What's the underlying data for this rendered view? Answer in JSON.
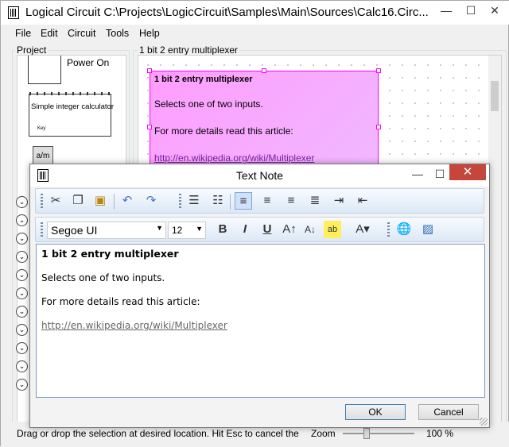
{
  "window": {
    "title": "Logical Circuit C:\\Projects\\LogicCircuit\\Samples\\Main\\Sources\\Calc16.Circ..."
  },
  "menu": [
    "File",
    "Edit",
    "Circuit",
    "Tools",
    "Help"
  ],
  "project": {
    "label": "Project",
    "power_on": "Power On",
    "calculator": "Simple integer calculator",
    "key": "Key",
    "am_button": "a/m",
    "circle_glyph": "⌄"
  },
  "canvas": {
    "label": "1 bit 2 entry multiplexer",
    "note": {
      "title": "1 bit 2 entry multiplexer",
      "line1": "Selects one of two inputs.",
      "line2": "For more details read this article:",
      "link": "http://en.wikipedia.org/wiki/Multiplexer"
    }
  },
  "status": {
    "text": "Drag or drop the selection at desired location. Hit Esc to cancel the",
    "zoom_label": "Zoom",
    "zoom_value": "100 %"
  },
  "dialog": {
    "title": "Text Note",
    "font_name": "Segoe UI",
    "font_size": "12",
    "bold": "B",
    "italic": "I",
    "underline": "U",
    "content": {
      "title": "1 bit 2 entry multiplexer",
      "line1": "Selects one of two inputs.",
      "line2": "For more details read this article:",
      "link": "http://en.wikipedia.org/wiki/Multiplexer"
    },
    "ok": "OK",
    "cancel": "Cancel"
  }
}
